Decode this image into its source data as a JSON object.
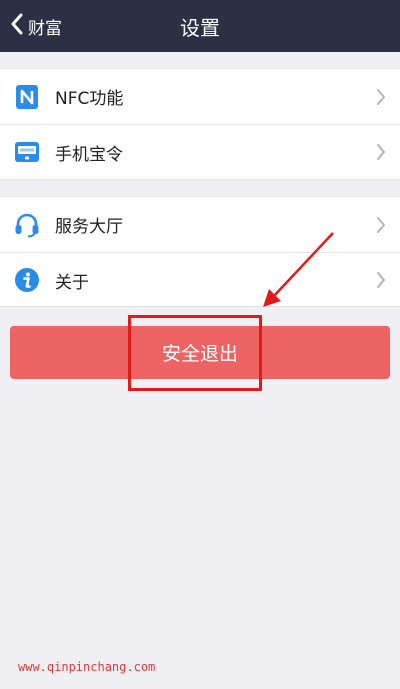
{
  "navbar": {
    "back_label": "财富",
    "title": "设置"
  },
  "groups": [
    {
      "items": [
        {
          "icon": "nfc-icon",
          "label": "NFC功能"
        },
        {
          "icon": "phone-token-icon",
          "label": "手机宝令"
        }
      ]
    },
    {
      "items": [
        {
          "icon": "headset-icon",
          "label": "服务大厅"
        },
        {
          "icon": "info-icon",
          "label": "关于"
        }
      ]
    }
  ],
  "logout": {
    "label": "安全退出"
  },
  "annotation": {
    "arrow": "arrow-icon",
    "box": "highlight-box"
  },
  "watermark": "www.qinpinchang.com",
  "colors": {
    "navbar": "#2b3044",
    "logout_button": "#ee6464",
    "icon_blue": "#2b8be8",
    "annotation_red": "#e11a1a",
    "background": "#efeff4"
  }
}
